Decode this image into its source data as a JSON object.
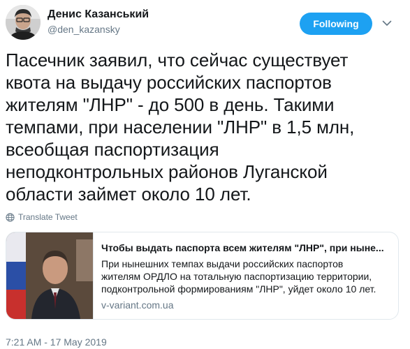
{
  "author": {
    "name": "Денис Казанський",
    "handle": "@den_kazansky"
  },
  "follow_button": {
    "label": "Following",
    "color": "#1da1f2"
  },
  "menu": {
    "icon": "chevron-down-icon"
  },
  "tweet": {
    "text_lines": [
      "Пасечник заявил, что сейчас существует",
      "квота на выдачу российских паспортов",
      "жителям \"ЛНР\" - до 500 в день. Такими",
      "темпами, при населении \"ЛНР\" в 1,5 млн,",
      "всеобщая паспортизация",
      "неподконтрольных районов Луганской",
      "области займет около 10 лет."
    ]
  },
  "translate": {
    "label": "Translate Tweet",
    "icon": "globe-icon"
  },
  "card": {
    "title": "Чтобы выдать паспорта всем жителям \"ЛНР\", при ныне...",
    "description_lines": [
      "При нынешних темпах выдачи российских паспортов",
      "жителям ОРДЛО на тотальную паспортизацию территории,",
      "подконтрольной формированиям \"ЛНР\", уйдет около 10 лет."
    ],
    "domain": "v-variant.com.ua"
  },
  "timestamp": "7:21 AM - 17 May 2019"
}
